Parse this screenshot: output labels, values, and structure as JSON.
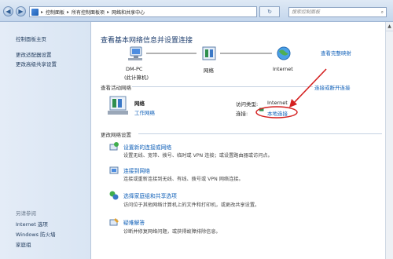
{
  "address": {
    "crumbs": [
      "控制面板",
      "所有控制面板项",
      "网络和共享中心"
    ],
    "search_placeholder": "搜索控制面板"
  },
  "sidebar": {
    "items": [
      "控制面板主页",
      "更改适配器设置",
      "更改高级共享设置"
    ],
    "see_also_label": "另请参阅",
    "see_also_items": [
      "Internet 选项",
      "Windows 防火墙",
      "家庭组"
    ]
  },
  "main": {
    "title": "查看基本网络信息并设置连接",
    "view_full_map": "查看完整映射",
    "map": {
      "pc_name": "DM-PC",
      "pc_sub": "(此计算机)",
      "network": "网络",
      "internet": "Internet"
    },
    "active_header": "查看活动网络",
    "connect_or_disconnect": "连接或断开连接",
    "network_name": "网络",
    "network_type": "工作网络",
    "access_type_label": "访问类型:",
    "access_type_value": "Internet",
    "connections_label": "连接:",
    "connections_value": "本地连接",
    "change_header": "更改网络设置",
    "tasks": [
      {
        "title": "设置新的连接或网络",
        "desc": "设置无线、宽带、拨号、临时或 VPN 连接；或设置路由器或访问点。"
      },
      {
        "title": "连接到网络",
        "desc": "连接或重新连接到无线、有线、拨号或 VPN 网络连接。"
      },
      {
        "title": "选择家庭组和共享选项",
        "desc": "访问位于其他网络计算机上的文件和打印机，或更改共享设置。"
      },
      {
        "title": "疑难解答",
        "desc": "诊断并修复网络问题，或获得故障排除信息。"
      }
    ]
  },
  "colors": {
    "link": "#1060b8",
    "annotation_arrow": "#d42020"
  }
}
